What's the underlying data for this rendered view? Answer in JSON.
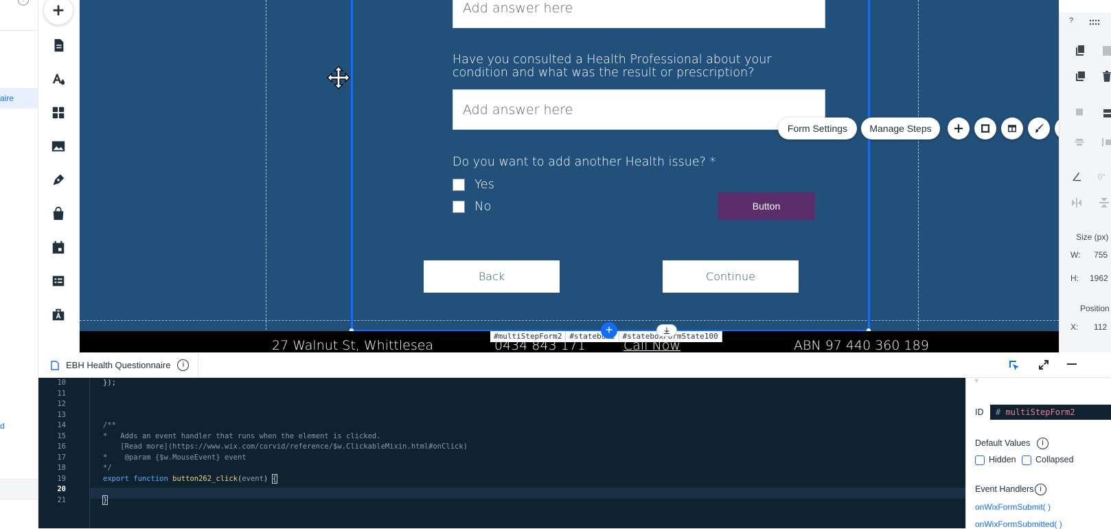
{
  "left_panel": {
    "selected_item_fragment": "aire",
    "mark_fragment": "d"
  },
  "canvas": {
    "answer_placeholder_1": "Add answer here",
    "answer_placeholder_2": "Add answer here",
    "question_2": "Have you consulted a Health Professional about your condition and what was the result or prescription?",
    "question_3": "Do you want to add another Health issue? *",
    "option_yes": "Yes",
    "option_no": "No",
    "button_label": "Button",
    "back_label": "Back",
    "continue_label": "Continue",
    "toolbar": {
      "form_settings": "Form Settings",
      "manage_steps": "Manage Steps"
    },
    "footer": {
      "address": "27 Walnut St, Whittlesea",
      "phone": "0434 843 171",
      "call_now": "Call Now",
      "abn": "ABN 97 440 360 189"
    },
    "id_tags": [
      "#multiStepForm2",
      "#statebox2",
      "#stateboxFormState100"
    ],
    "colors": {
      "canvas_bg": "#21507a",
      "selection": "#116dff",
      "purple_button": "#5a2d6b"
    }
  },
  "inspector": {
    "help": "?",
    "size_label": "Size (px)",
    "w_label": "W:",
    "w_value": "755",
    "h_label": "H:",
    "h_value": "1962",
    "position_label": "Position",
    "x_label": "X:",
    "x_value": "112",
    "angle_value": "0°"
  },
  "code_panel": {
    "tab_title": "EBH Health Questionnaire",
    "lines": [
      {
        "n": "10",
        "text": "});"
      },
      {
        "n": "11",
        "text": ""
      },
      {
        "n": "12",
        "text": ""
      },
      {
        "n": "13",
        "text": ""
      },
      {
        "n": "14",
        "text": "/**"
      },
      {
        "n": "15",
        "text": "*   Adds an event handler that runs when the element is clicked."
      },
      {
        "n": "16",
        "text": "    [Read more](https://www.wix.com/corvid/reference/$w.ClickableMixin.html#onClick)"
      },
      {
        "n": "17",
        "text": "*    @param {$w.MouseEvent} event"
      },
      {
        "n": "18",
        "text": "*/"
      },
      {
        "n": "19",
        "text": "export function button262_click(event) {"
      },
      {
        "n": "20",
        "text": ""
      },
      {
        "n": "21",
        "text": "}"
      }
    ]
  },
  "properties": {
    "id_label": "ID",
    "id_hash": "#",
    "id_value": "multiStepForm2",
    "default_values_label": "Default Values",
    "hidden_label": "Hidden",
    "collapsed_label": "Collapsed",
    "event_handlers_label": "Event Handlers",
    "handler_1": "onWixFormSubmit( )",
    "handler_2": "onWixFormSubmitted( )"
  }
}
